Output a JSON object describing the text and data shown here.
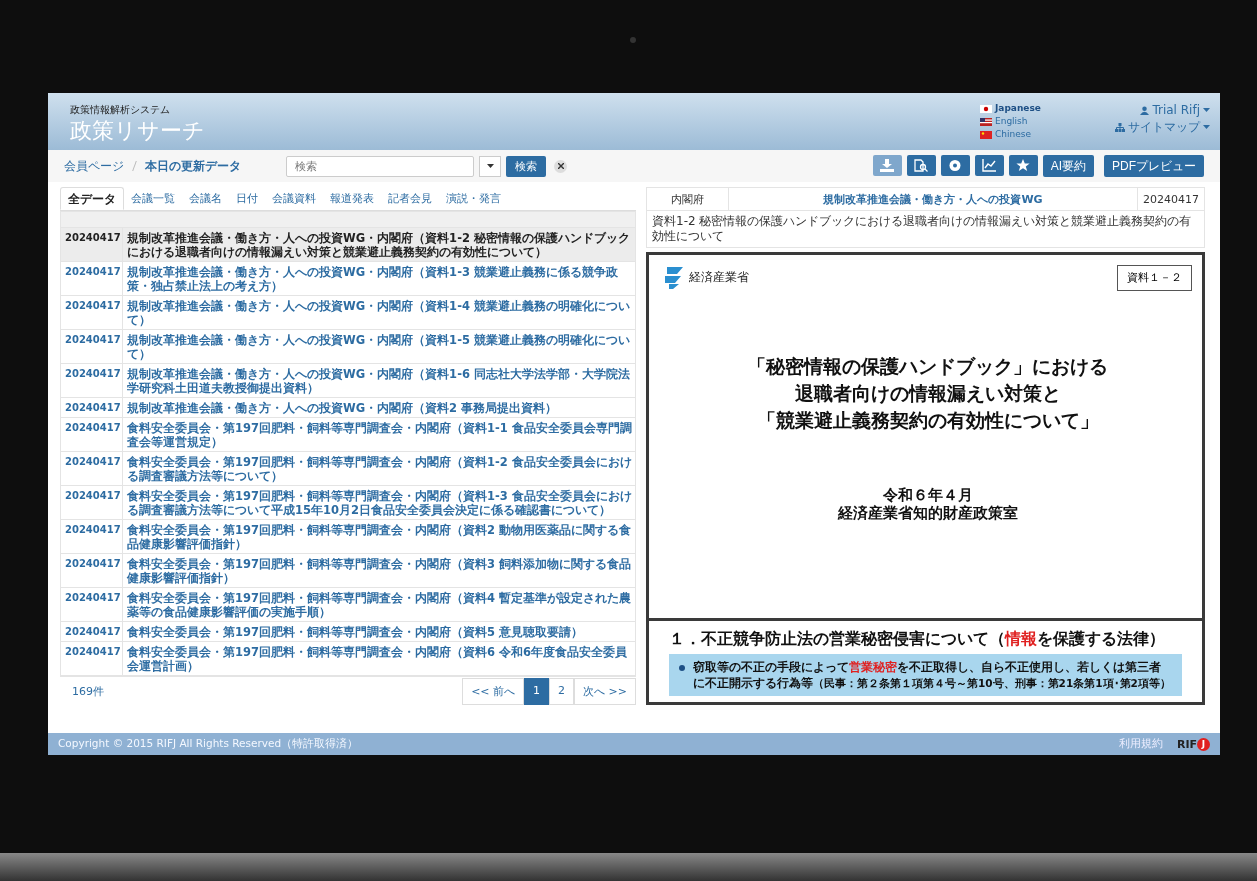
{
  "app": {
    "subtitle": "政策情報解析システム",
    "title": "政策リサーチ"
  },
  "languages": [
    {
      "label": "Japanese",
      "kind": "jp",
      "selected": true
    },
    {
      "label": "English",
      "kind": "us",
      "selected": false
    },
    {
      "label": "Chinese",
      "kind": "cn",
      "selected": false
    }
  ],
  "user_menu": {
    "label": "Trial Rifj"
  },
  "sitemap": {
    "label": "サイトマップ"
  },
  "breadcrumb": [
    "会員ページ",
    "本日の更新データ"
  ],
  "search": {
    "placeholder": "検索",
    "button": "検索"
  },
  "tool_buttons": [
    {
      "kind": "download",
      "disabled": true
    },
    {
      "kind": "doc-search",
      "disabled": false
    },
    {
      "kind": "disc",
      "disabled": false
    },
    {
      "kind": "chart",
      "disabled": false
    },
    {
      "kind": "star",
      "disabled": false
    }
  ],
  "text_buttons": [
    "AI要約",
    "PDFプレビュー"
  ],
  "tabs": [
    {
      "label": "全データ",
      "selected": true
    },
    {
      "label": "会議一覧",
      "selected": false
    },
    {
      "label": "会議名",
      "selected": false
    },
    {
      "label": "日付",
      "selected": false
    },
    {
      "label": "会議資料",
      "selected": false
    },
    {
      "label": "報道発表",
      "selected": false
    },
    {
      "label": "記者会見",
      "selected": false
    },
    {
      "label": "演説・発言",
      "selected": false
    }
  ],
  "rows": [
    {
      "date": "20240417",
      "title": "規制改革推進会議・働き方・人への投資WG・内閣府（資料1-2 秘密情報の保護ハンドブックにおける退職者向けの情報漏えい対策と競業避止義務契約の有効性について）",
      "selected": true
    },
    {
      "date": "20240417",
      "title": "規制改革推進会議・働き方・人への投資WG・内閣府（資料1-3 競業避止義務に係る競争政策・独占禁止法上の考え方）",
      "selected": false
    },
    {
      "date": "20240417",
      "title": "規制改革推進会議・働き方・人への投資WG・内閣府（資料1-4 競業避止義務の明確化について）",
      "selected": false
    },
    {
      "date": "20240417",
      "title": "規制改革推進会議・働き方・人への投資WG・内閣府（資料1-5 競業避止義務の明確化について）",
      "selected": false
    },
    {
      "date": "20240417",
      "title": "規制改革推進会議・働き方・人への投資WG・内閣府（資料1-6 同志社大学法学部・大学院法学研究科土田道夫教授御提出資料）",
      "selected": false
    },
    {
      "date": "20240417",
      "title": "規制改革推進会議・働き方・人への投資WG・内閣府（資料2 事務局提出資料）",
      "selected": false
    },
    {
      "date": "20240417",
      "title": "食料安全委員会・第197回肥料・飼料等専門調査会・内閣府（資料1-1 食品安全委員会専門調査会等運営規定）",
      "selected": false
    },
    {
      "date": "20240417",
      "title": "食料安全委員会・第197回肥料・飼料等専門調査会・内閣府（資料1-2 食品安全委員会における調査審議方法等について）",
      "selected": false
    },
    {
      "date": "20240417",
      "title": "食料安全委員会・第197回肥料・飼料等専門調査会・内閣府（資料1-3 食品安全委員会における調査審議方法等について平成15年10月2日食品安全委員会決定に係る確認書について）",
      "selected": false
    },
    {
      "date": "20240417",
      "title": "食料安全委員会・第197回肥料・飼料等専門調査会・内閣府（資料2 動物用医薬品に関する食品健康影響評価指針）",
      "selected": false
    },
    {
      "date": "20240417",
      "title": "食料安全委員会・第197回肥料・飼料等専門調査会・内閣府（資料3 飼料添加物に関する食品健康影響評価指針）",
      "selected": false
    },
    {
      "date": "20240417",
      "title": "食料安全委員会・第197回肥料・飼料等専門調査会・内閣府（資料4 暫定基準が設定された農薬等の食品健康影響評価の実施手順）",
      "selected": false
    },
    {
      "date": "20240417",
      "title": "食料安全委員会・第197回肥料・飼料等専門調査会・内閣府（資料5 意見聴取要請）",
      "selected": false
    },
    {
      "date": "20240417",
      "title": "食料安全委員会・第197回肥料・飼料等専門調査会・内閣府（資料6 令和6年度食品安全委員会運営計画）",
      "selected": false
    }
  ],
  "count": "169件",
  "pagination": {
    "prev": "<< 前へ",
    "pages": [
      {
        "label": "1",
        "selected": true
      },
      {
        "label": "2",
        "selected": false
      }
    ],
    "next": "次へ >>"
  },
  "detail": {
    "agency": "内閣府",
    "meeting": "規制改革推進会議・働き方・人への投資WG",
    "date": "20240417",
    "description": "資料1-2 秘密情報の保護ハンドブックにおける退職者向けの情報漏えい対策と競業避止義務契約の有効性について",
    "document": {
      "ministry": "経済産業省",
      "doc_no": "資料１－２",
      "title_lines": [
        "「秘密情報の保護ハンドブック」における",
        "退職者向けの情報漏えい対策と",
        "「競業避止義務契約の有効性について」"
      ],
      "date": "令和６年４月",
      "office": "経済産業省知的財産政策室",
      "heading": [
        {
          "text": "１．不正競争防止法の営業秘密侵害について（",
          "kind": "normal"
        },
        {
          "text": "情報",
          "kind": "red"
        },
        {
          "text": "を保護する法律）",
          "kind": "normal"
        }
      ],
      "bullet": [
        {
          "text": "窃取等の不正の手段によって",
          "kind": "normal"
        },
        {
          "text": "営業秘密",
          "kind": "red"
        },
        {
          "text": "を不正取得し、自ら不正使用し、若しくは第三者に不正開示する行為等",
          "kind": "normal"
        },
        {
          "text": "（民事：第２条第１項第４号～第10号、刑事：第21条第1項･第2項等）",
          "kind": "small"
        }
      ]
    }
  },
  "footer": {
    "copyright": "Copyright © 2015 RIFJ All Rights Reserved（特許取得済）",
    "terms": "利用規約",
    "logo": "RIF",
    "logo_mark": "J"
  }
}
